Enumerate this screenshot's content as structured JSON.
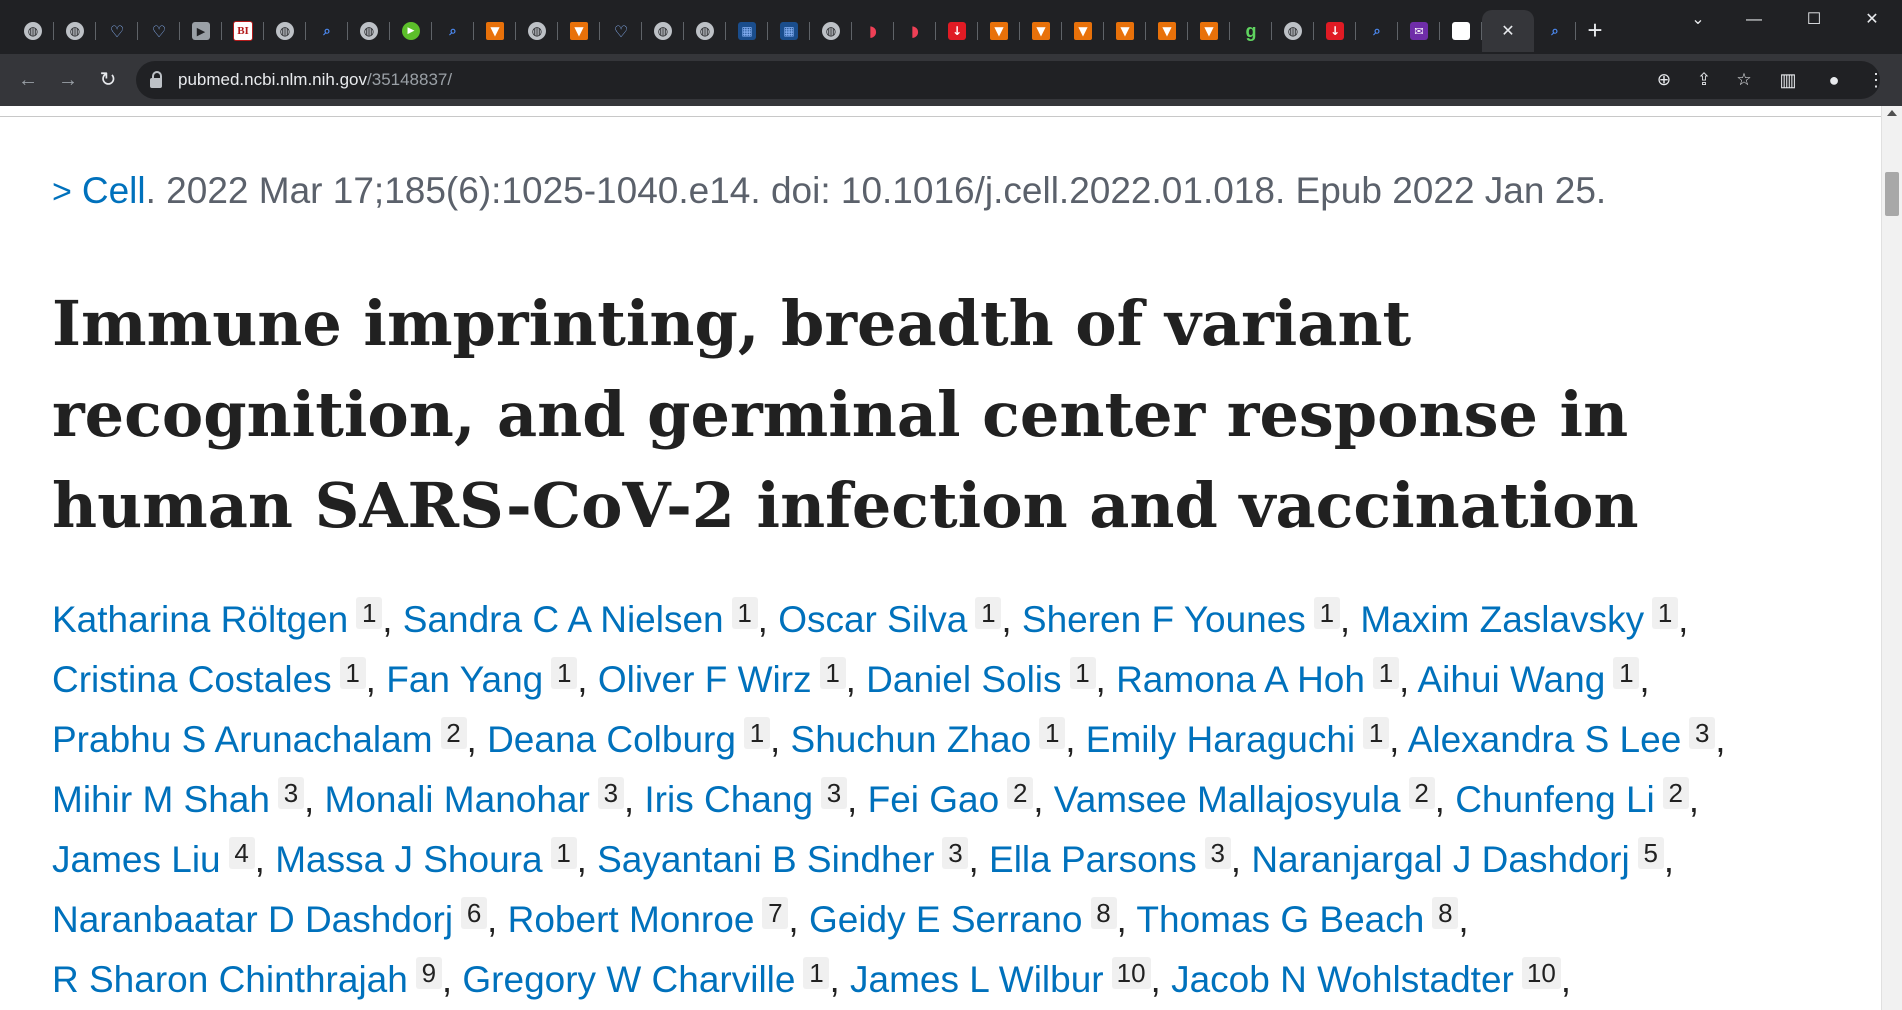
{
  "browser": {
    "tab_favicons": [
      "globe",
      "globe",
      "shield",
      "shield",
      "arrow",
      "bi",
      "globe",
      "search",
      "globe",
      "play",
      "search",
      "book",
      "globe",
      "book",
      "shield",
      "globe",
      "globe",
      "cube",
      "cube",
      "globe",
      "pocket",
      "pocket",
      "red",
      "book",
      "book",
      "book",
      "book",
      "book",
      "book",
      "g",
      "globe",
      "red",
      "search",
      "purple",
      "white"
    ],
    "bi_favicon_text": "BI",
    "g_favicon_text": "g",
    "active_tab_close": "✕",
    "new_tab": "+",
    "url_host": "pubmed.ncbi.nlm.nih.gov",
    "url_path": "/35148837/"
  },
  "article": {
    "journal": "Cell",
    "citation_rest": ". 2022 Mar 17;185(6):1025-1040.e14. doi: 10.1016/j.cell.2022.01.018. Epub 2022 Jan 25.",
    "title": "Immune imprinting, breadth of variant recognition, and germinal center response in human SARS-CoV-2 infection and vaccination",
    "authors": [
      {
        "name": "Katharina Röltgen",
        "aff": "1"
      },
      {
        "name": "Sandra C A Nielsen",
        "aff": "1"
      },
      {
        "name": "Oscar Silva",
        "aff": "1"
      },
      {
        "name": "Sheren F Younes",
        "aff": "1"
      },
      {
        "name": "Maxim Zaslavsky",
        "aff": "1"
      },
      {
        "name": "Cristina Costales",
        "aff": "1"
      },
      {
        "name": "Fan Yang",
        "aff": "1"
      },
      {
        "name": "Oliver F Wirz",
        "aff": "1"
      },
      {
        "name": "Daniel Solis",
        "aff": "1"
      },
      {
        "name": "Ramona A Hoh",
        "aff": "1"
      },
      {
        "name": "Aihui Wang",
        "aff": "1"
      },
      {
        "name": "Prabhu S Arunachalam",
        "aff": "2"
      },
      {
        "name": "Deana Colburg",
        "aff": "1"
      },
      {
        "name": "Shuchun Zhao",
        "aff": "1"
      },
      {
        "name": "Emily Haraguchi",
        "aff": "1"
      },
      {
        "name": "Alexandra S Lee",
        "aff": "3"
      },
      {
        "name": "Mihir M Shah",
        "aff": "3"
      },
      {
        "name": "Monali Manohar",
        "aff": "3"
      },
      {
        "name": "Iris Chang",
        "aff": "3"
      },
      {
        "name": "Fei Gao",
        "aff": "2"
      },
      {
        "name": "Vamsee Mallajosyula",
        "aff": "2"
      },
      {
        "name": "Chunfeng Li",
        "aff": "2"
      },
      {
        "name": "James Liu",
        "aff": "4"
      },
      {
        "name": "Massa J Shoura",
        "aff": "1"
      },
      {
        "name": "Sayantani B Sindher",
        "aff": "3"
      },
      {
        "name": "Ella Parsons",
        "aff": "3"
      },
      {
        "name": "Naranjargal J Dashdorj",
        "aff": "5"
      },
      {
        "name": "Naranbaatar D Dashdorj",
        "aff": "6"
      },
      {
        "name": "Robert Monroe",
        "aff": "7"
      },
      {
        "name": "Geidy E Serrano",
        "aff": "8"
      },
      {
        "name": "Thomas G Beach",
        "aff": "8"
      },
      {
        "name": "R Sharon Chinthrajah",
        "aff": "9"
      },
      {
        "name": "Gregory W Charville",
        "aff": "1"
      },
      {
        "name": "James L Wilbur",
        "aff": "10"
      },
      {
        "name": "Jacob N Wohlstadter",
        "aff": "10"
      }
    ]
  }
}
